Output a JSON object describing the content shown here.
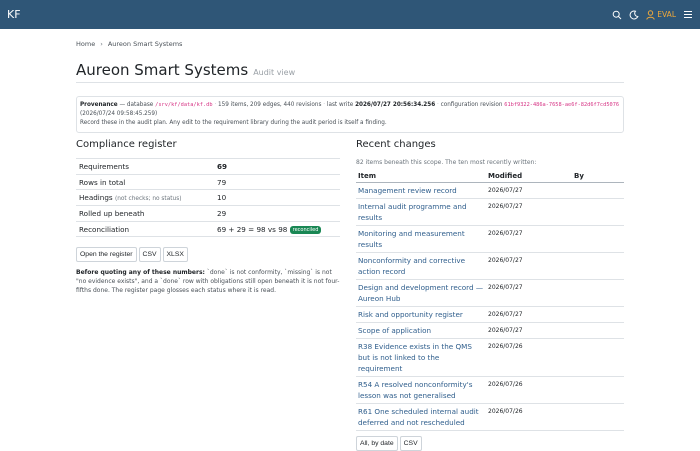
{
  "header": {
    "brand": "KF",
    "user": "EVAL"
  },
  "breadcrumb": [
    "Home",
    "Aureon Smart Systems"
  ],
  "page": {
    "title": "Aureon Smart Systems",
    "subtitle": "Audit view"
  },
  "provenance": {
    "label": "Provenance",
    "dash": "— database",
    "db_path": "/srv/kf/data/kf.db",
    "stats": "159 items, 209 edges, 440 revisions",
    "last_write_label": "last write",
    "last_write": "2026/07/27 20:56:34.256",
    "config_label": "configuration revision",
    "config_rev": "61bf9322-486a-7658-ae6f-82d6f7cd5076",
    "config_date": "(2026/07/24 09:58:45.259)",
    "note": "Record these in the audit plan. Any edit to the requirement library during the audit period is itself a finding."
  },
  "compliance": {
    "heading": "Compliance register",
    "rows": [
      {
        "key": "Requirements",
        "hint": "",
        "value": "69",
        "bold": true
      },
      {
        "key": "Rows in total",
        "hint": "",
        "value": "79"
      },
      {
        "key": "Headings",
        "hint": "(not checks; no status)",
        "value": "10"
      },
      {
        "key": "Rolled up beneath",
        "hint": "",
        "value": "29"
      },
      {
        "key": "Reconciliation",
        "hint": "",
        "value": "69 + 29 = 98 vs 98",
        "badge": "reconciled"
      }
    ],
    "buttons": [
      "Open the register",
      "CSV",
      "XLSX"
    ],
    "note_bold": "Before quoting any of these numbers:",
    "note": "`done` is not conformity, `missing` is not \"no evidence exists\", and a `done` row with obligations still open beneath it is not four-fifths done. The register page glosses each status where it is read."
  },
  "recent": {
    "heading": "Recent changes",
    "intro": "82 items beneath this scope. The ten most recently written:",
    "columns": [
      "Item",
      "Modified",
      "By"
    ],
    "rows": [
      {
        "item": "Management review record",
        "modified": "2026/07/27",
        "by": ""
      },
      {
        "item": "Internal audit programme and results",
        "modified": "2026/07/27",
        "by": ""
      },
      {
        "item": "Monitoring and measurement results",
        "modified": "2026/07/27",
        "by": ""
      },
      {
        "item": "Nonconformity and corrective action record",
        "modified": "2026/07/27",
        "by": ""
      },
      {
        "item": "Design and development record — Aureon Hub",
        "modified": "2026/07/27",
        "by": ""
      },
      {
        "item": "Risk and opportunity register",
        "modified": "2026/07/27",
        "by": ""
      },
      {
        "item": "Scope of application",
        "modified": "2026/07/27",
        "by": ""
      },
      {
        "item": "R38 Evidence exists in the QMS but is not linked to the requirement",
        "modified": "2026/07/26",
        "by": ""
      },
      {
        "item": "R54 A resolved nonconformity's lesson was not generalised",
        "modified": "2026/07/26",
        "by": ""
      },
      {
        "item": "R61 One scheduled internal audit deferred and not rescheduled",
        "modified": "2026/07/26",
        "by": ""
      }
    ],
    "buttons": [
      "All, by date",
      "CSV"
    ]
  },
  "colors": {
    "topbar": "#2f5677",
    "link": "#2f5e8c",
    "accent": "#f0a93b",
    "badge": "#198754",
    "code": "#d63384"
  }
}
